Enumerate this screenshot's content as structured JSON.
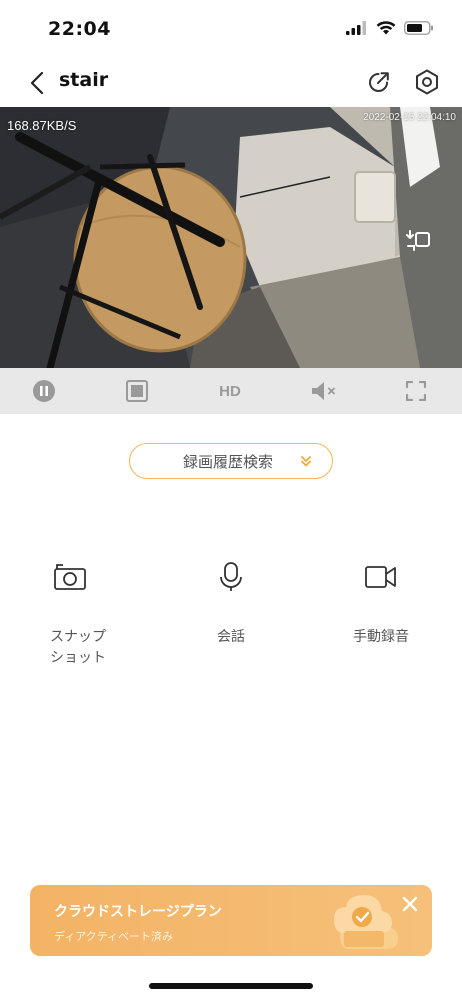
{
  "status_bar": {
    "time": "22:04"
  },
  "nav": {
    "title": "stair"
  },
  "video": {
    "bitrate": "168.87KB/S",
    "timestamp": "2022-02-15 22:04:10"
  },
  "controls": {
    "hd_label": "HD"
  },
  "playback": {
    "label": "録画履歴検索"
  },
  "actions": {
    "snapshot_line1": "スナップ",
    "snapshot_line2": "ショット",
    "talk": "会話",
    "record": "手動録音"
  },
  "cloud": {
    "title": "クラウドストレージプラン",
    "subtitle": "ディアクティベート済み"
  },
  "colors": {
    "accent": "#f2b558",
    "banner": "#f3b365",
    "control_bar": "#e8e8e8",
    "icon": "#333333"
  }
}
